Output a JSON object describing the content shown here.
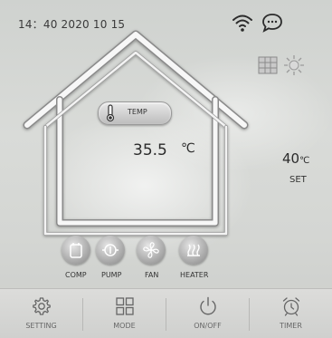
{
  "status": {
    "datetime": "14：40 2020 10 15",
    "wifi_icon": "wifi-icon",
    "message_icon": "message-icon"
  },
  "temperature": {
    "label": "TEMP",
    "value": "35.5",
    "unit": "℃"
  },
  "setpoint": {
    "value": "40",
    "unit": "℃",
    "label": "SET"
  },
  "mode_indicators": [
    {
      "icon": "grid-mode-icon"
    },
    {
      "icon": "sun-mode-icon"
    }
  ],
  "components": [
    {
      "label": "COMP",
      "icon": "compressor-icon"
    },
    {
      "label": "PUMP",
      "icon": "pump-icon"
    },
    {
      "label": "FAN",
      "icon": "fan-icon"
    },
    {
      "label": "HEATER",
      "icon": "heater-icon"
    }
  ],
  "nav": [
    {
      "label": "SETTING",
      "icon": "gear-icon"
    },
    {
      "label": "MODE",
      "icon": "grid-icon"
    },
    {
      "label": "ON/OFF",
      "icon": "power-icon"
    },
    {
      "label": "TIMER",
      "icon": "alarm-clock-icon"
    }
  ],
  "colors": {
    "background": "#d5d7d4",
    "house_outline": "#f4f4f4",
    "text": "#2b2b2b",
    "nav_bar": "#d6d6d4"
  }
}
